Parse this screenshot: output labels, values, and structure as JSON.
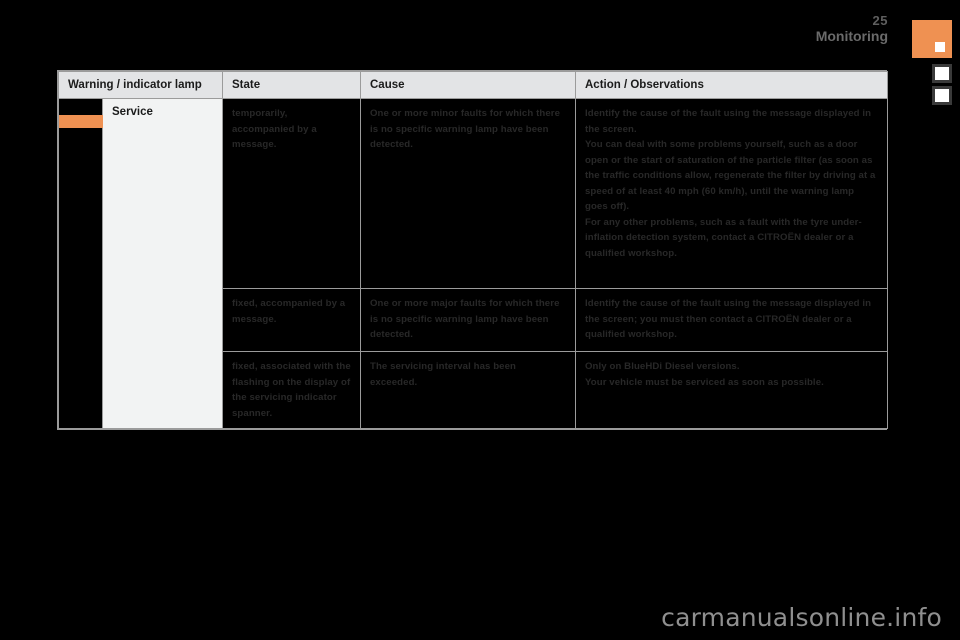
{
  "header": {
    "page_number": "25",
    "section_title": "Monitoring",
    "tab_marker_icon": "orange-section-tab",
    "tab_small_1_icon": "section-tab-marker",
    "tab_small_2_icon": "section-tab-marker"
  },
  "table": {
    "columns": [
      "Warning / indicator lamp",
      "State",
      "Cause",
      "Action / Observations"
    ],
    "lamp": {
      "icon": "service-spanner-warning-lamp",
      "name": "Service"
    },
    "rows": [
      {
        "state": "temporarily, accompanied by a message.",
        "cause": "One or more minor faults for which there is no specific warning lamp have been detected.",
        "action": [
          "Identify the cause of the fault using the message displayed in the screen.",
          "You can deal with some problems yourself, such as a door open or the start of saturation of the particle filter (as soon as the traffic conditions allow, regenerate the filter by driving at a speed of at least 40 mph (60 km/h), until the warning lamp goes off).",
          "For any other problems, such as a fault with the tyre under-inflation detection system, contact a CITROËN dealer or a qualified workshop."
        ]
      },
      {
        "state": "fixed, accompanied by a message.",
        "cause": "One or more major faults for which there is no specific warning lamp have been detected.",
        "action": [
          "Identify the cause of the fault using the message displayed in the screen; you must then contact a CITROËN dealer or a qualified workshop."
        ]
      },
      {
        "state": "fixed, associated with the flashing on the display of the servicing indicator spanner.",
        "cause": "The servicing interval has been exceeded.",
        "action": [
          "Only on BlueHDi Diesel versions.",
          "Your vehicle must be serviced as soon as possible."
        ]
      }
    ]
  },
  "watermark": "carmanualsonline.info"
}
